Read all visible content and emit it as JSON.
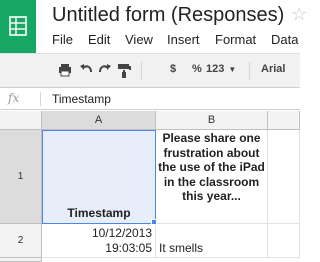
{
  "app": {
    "title": "Untitled form (Responses)",
    "icon": "sheets-icon",
    "brand_color": "#16a765"
  },
  "menubar": {
    "items": [
      "File",
      "Edit",
      "View",
      "Insert",
      "Format",
      "Data"
    ]
  },
  "toolbar": {
    "currency_label": "$",
    "percent_label": "%",
    "number_format_label": "123",
    "font_label": "Arial"
  },
  "formula_bar": {
    "fx_label": "fx",
    "value": "Timestamp"
  },
  "grid": {
    "columns": [
      "A",
      "B"
    ],
    "rows": [
      "1",
      "2"
    ],
    "cells": {
      "A1": "Timestamp",
      "B1": "Please share one frustration about the use of the iPad in the classroom this year...",
      "A2_date": "10/12/2013",
      "A2_time": "19:03:05",
      "B2": "It smells"
    },
    "selection_color": "#4a86e8"
  }
}
